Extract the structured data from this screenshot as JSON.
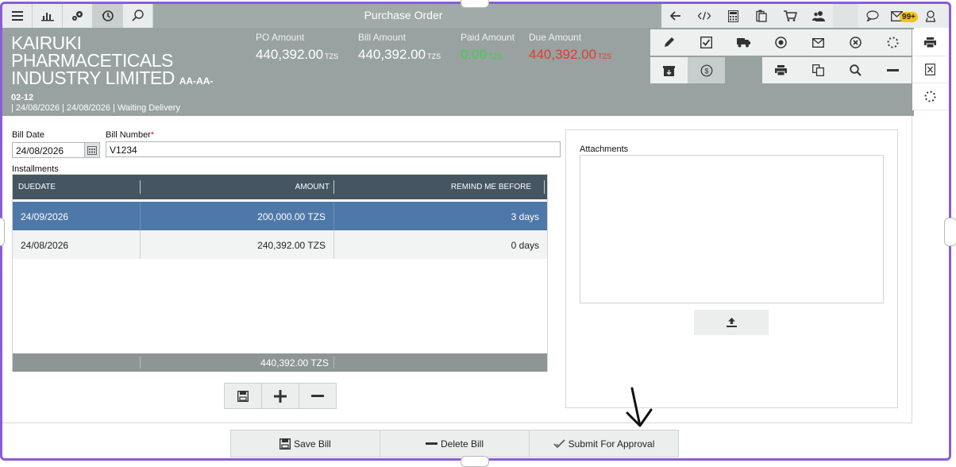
{
  "app": {
    "title": "Purchase Order"
  },
  "toolbar": {
    "notification_count": "99+"
  },
  "company": {
    "name_line1": "KAIRUKI",
    "name_line2": "PHARMACETICALS",
    "name_line3": "INDUSTRY LIMITED",
    "code": "AA-AA-",
    "code_line2": "02-12"
  },
  "summary": {
    "meta": "| 24/08/2026 | 24/08/2026 | Waiting Delivery",
    "po_amount": {
      "label": "PO Amount",
      "value": "440,392.00",
      "currency": "TZS"
    },
    "bill_amount": {
      "label": "Bill Amount",
      "value": "440,392.00",
      "currency": "TZS"
    },
    "paid_amount": {
      "label": "Paid Amount",
      "value": "0.00",
      "currency": "TZS"
    },
    "due_amount": {
      "label": "Due Amount",
      "value": "440,392.00",
      "currency": "TZS"
    }
  },
  "colors": {
    "paid": "#3ecf4a",
    "due": "#e23b2e",
    "selected_row": "#4e78a8",
    "header": "#455562"
  },
  "form": {
    "bill_date_label": "Bill Date",
    "bill_date_value": "24/08/2026",
    "bill_number_label": "Bill Number",
    "bill_number_required": "*",
    "bill_number_value": "V1234",
    "installments_label": "Installments"
  },
  "installments": {
    "columns": [
      "DUEDATE",
      "AMOUNT",
      "REMIND ME BEFORE"
    ],
    "rows": [
      {
        "due": "24/09/2026",
        "amount": "200,000.00 TZS",
        "remind": "3 days"
      },
      {
        "due": "24/08/2026",
        "amount": "240,392.00 TZS",
        "remind": "0 days"
      }
    ],
    "total": "440,392.00 TZS"
  },
  "attachments": {
    "label": "Attachments"
  },
  "footer": {
    "save": "Save Bill",
    "delete": "Delete Bill",
    "submit": "Submit For Approval"
  }
}
